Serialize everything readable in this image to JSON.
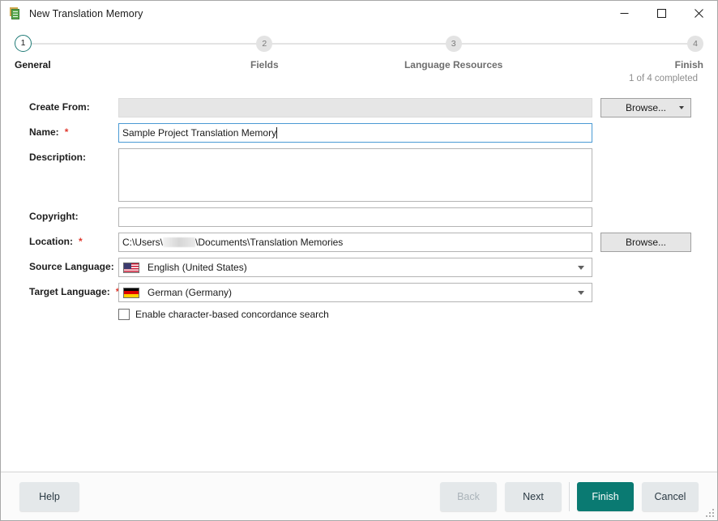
{
  "window": {
    "title": "New Translation Memory",
    "icon": "translation-memory-icon",
    "controls": {
      "minimize": "minimize-icon",
      "maximize": "maximize-icon",
      "close": "close-icon"
    }
  },
  "stepper": {
    "progress_text": "1 of 4 completed",
    "active_index": 0,
    "steps": [
      {
        "number": "1",
        "label": "General"
      },
      {
        "number": "2",
        "label": "Fields"
      },
      {
        "number": "3",
        "label": "Language Resources"
      },
      {
        "number": "4",
        "label": "Finish"
      }
    ]
  },
  "form": {
    "create_from": {
      "label": "Create From:",
      "value": "",
      "placeholder": "",
      "disabled": true
    },
    "name": {
      "label": "Name:",
      "required_marker": "*",
      "value": "Sample Project Translation Memory",
      "focused": true
    },
    "description": {
      "label": "Description:",
      "value": ""
    },
    "copyright": {
      "label": "Copyright:",
      "value": ""
    },
    "location": {
      "label": "Location:",
      "required_marker": "*",
      "value_prefix": "C:\\Users\\",
      "value_suffix": "\\Documents\\Translation Memories",
      "redacted": true
    },
    "source_language": {
      "label": "Source Language:",
      "required_marker": "*",
      "value": "English (United States)",
      "flag": "flag-us-icon"
    },
    "target_language": {
      "label": "Target Language:",
      "required_marker": "*",
      "value": "German (Germany)",
      "flag": "flag-de-icon"
    },
    "concordance": {
      "label": "Enable character-based concordance search",
      "checked": false
    },
    "browse_create_from": "Browse...",
    "browse_location": "Browse..."
  },
  "footer": {
    "help": "Help",
    "back": "Back",
    "next": "Next",
    "finish": "Finish",
    "cancel": "Cancel",
    "back_disabled": true
  },
  "colors": {
    "accent": "#0a7a72",
    "step_active_ring": "#1f7a76",
    "required": "#e03a2f",
    "focus_border": "#4a9ad4"
  }
}
